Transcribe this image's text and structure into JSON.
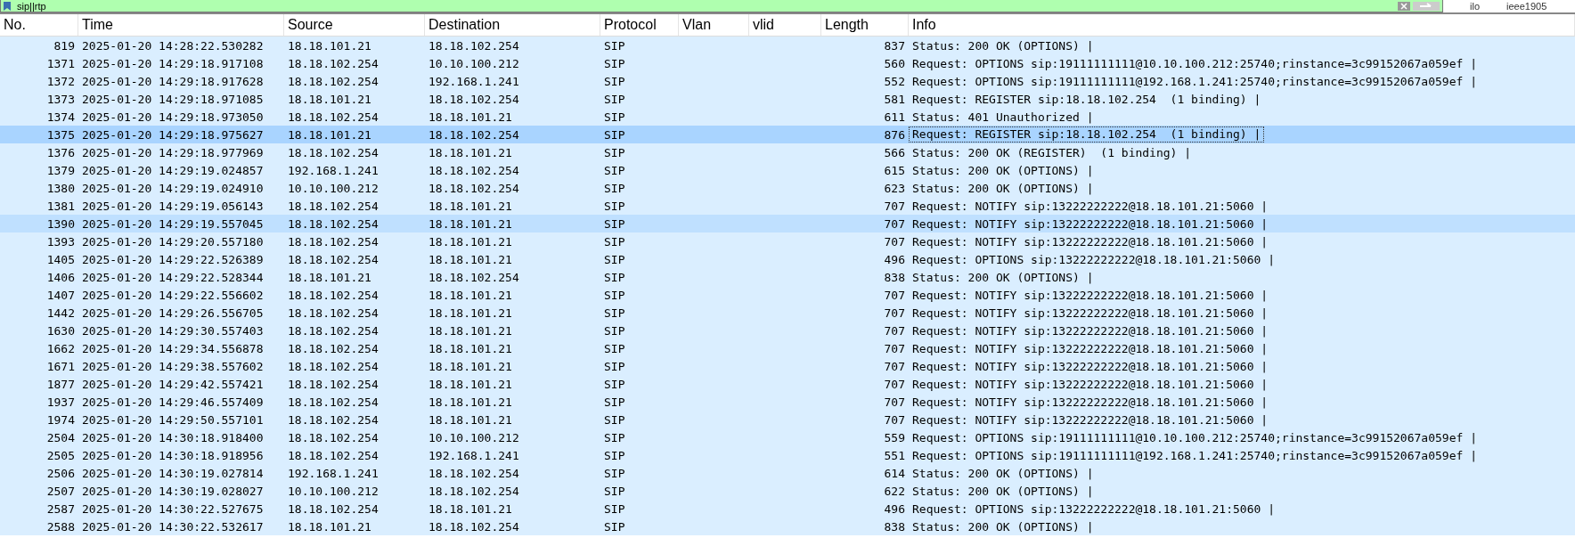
{
  "filter_bar": {
    "value": "sip||rtp",
    "buttons": [
      "ilo",
      "ieee1905"
    ]
  },
  "table": {
    "columns": [
      "No.",
      "Time",
      "Source",
      "Destination",
      "Protocol",
      "Vlan",
      "vlid",
      "Length",
      "Info"
    ],
    "rows": [
      {
        "no": "819",
        "time": "2025-01-20 14:28:22.530282",
        "source": "18.18.101.21",
        "destination": "18.18.102.254",
        "protocol": "SIP",
        "length": "837",
        "info": "Status: 200 OK (OPTIONS) |",
        "selected": false,
        "hover": false
      },
      {
        "no": "1371",
        "time": "2025-01-20 14:29:18.917108",
        "source": "18.18.102.254",
        "destination": "10.10.100.212",
        "protocol": "SIP",
        "length": "560",
        "info": "Request: OPTIONS sip:19111111111@10.10.100.212:25740;rinstance=3c99152067a059ef |",
        "selected": false,
        "hover": false
      },
      {
        "no": "1372",
        "time": "2025-01-20 14:29:18.917628",
        "source": "18.18.102.254",
        "destination": "192.168.1.241",
        "protocol": "SIP",
        "length": "552",
        "info": "Request: OPTIONS sip:19111111111@192.168.1.241:25740;rinstance=3c99152067a059ef |",
        "selected": false,
        "hover": false
      },
      {
        "no": "1373",
        "time": "2025-01-20 14:29:18.971085",
        "source": "18.18.101.21",
        "destination": "18.18.102.254",
        "protocol": "SIP",
        "length": "581",
        "info": "Request: REGISTER sip:18.18.102.254  (1 binding) |",
        "selected": false,
        "hover": false
      },
      {
        "no": "1374",
        "time": "2025-01-20 14:29:18.973050",
        "source": "18.18.102.254",
        "destination": "18.18.101.21",
        "protocol": "SIP",
        "length": "611",
        "info": "Status: 401 Unauthorized |",
        "selected": false,
        "hover": false
      },
      {
        "no": "1375",
        "time": "2025-01-20 14:29:18.975627",
        "source": "18.18.101.21",
        "destination": "18.18.102.254",
        "protocol": "SIP",
        "length": "876",
        "info": "Request: REGISTER sip:18.18.102.254  (1 binding) |",
        "selected": true,
        "hover": false
      },
      {
        "no": "1376",
        "time": "2025-01-20 14:29:18.977969",
        "source": "18.18.102.254",
        "destination": "18.18.101.21",
        "protocol": "SIP",
        "length": "566",
        "info": "Status: 200 OK (REGISTER)  (1 binding) |",
        "selected": false,
        "hover": false
      },
      {
        "no": "1379",
        "time": "2025-01-20 14:29:19.024857",
        "source": "192.168.1.241",
        "destination": "18.18.102.254",
        "protocol": "SIP",
        "length": "615",
        "info": "Status: 200 OK (OPTIONS) |",
        "selected": false,
        "hover": false
      },
      {
        "no": "1380",
        "time": "2025-01-20 14:29:19.024910",
        "source": "10.10.100.212",
        "destination": "18.18.102.254",
        "protocol": "SIP",
        "length": "623",
        "info": "Status: 200 OK (OPTIONS) |",
        "selected": false,
        "hover": false
      },
      {
        "no": "1381",
        "time": "2025-01-20 14:29:19.056143",
        "source": "18.18.102.254",
        "destination": "18.18.101.21",
        "protocol": "SIP",
        "length": "707",
        "info": "Request: NOTIFY sip:13222222222@18.18.101.21:5060 |",
        "selected": false,
        "hover": false
      },
      {
        "no": "1390",
        "time": "2025-01-20 14:29:19.557045",
        "source": "18.18.102.254",
        "destination": "18.18.101.21",
        "protocol": "SIP",
        "length": "707",
        "info": "Request: NOTIFY sip:13222222222@18.18.101.21:5060 |",
        "selected": false,
        "hover": true
      },
      {
        "no": "1393",
        "time": "2025-01-20 14:29:20.557180",
        "source": "18.18.102.254",
        "destination": "18.18.101.21",
        "protocol": "SIP",
        "length": "707",
        "info": "Request: NOTIFY sip:13222222222@18.18.101.21:5060 |",
        "selected": false,
        "hover": false
      },
      {
        "no": "1405",
        "time": "2025-01-20 14:29:22.526389",
        "source": "18.18.102.254",
        "destination": "18.18.101.21",
        "protocol": "SIP",
        "length": "496",
        "info": "Request: OPTIONS sip:13222222222@18.18.101.21:5060 |",
        "selected": false,
        "hover": false
      },
      {
        "no": "1406",
        "time": "2025-01-20 14:29:22.528344",
        "source": "18.18.101.21",
        "destination": "18.18.102.254",
        "protocol": "SIP",
        "length": "838",
        "info": "Status: 200 OK (OPTIONS) |",
        "selected": false,
        "hover": false
      },
      {
        "no": "1407",
        "time": "2025-01-20 14:29:22.556602",
        "source": "18.18.102.254",
        "destination": "18.18.101.21",
        "protocol": "SIP",
        "length": "707",
        "info": "Request: NOTIFY sip:13222222222@18.18.101.21:5060 |",
        "selected": false,
        "hover": false
      },
      {
        "no": "1442",
        "time": "2025-01-20 14:29:26.556705",
        "source": "18.18.102.254",
        "destination": "18.18.101.21",
        "protocol": "SIP",
        "length": "707",
        "info": "Request: NOTIFY sip:13222222222@18.18.101.21:5060 |",
        "selected": false,
        "hover": false
      },
      {
        "no": "1630",
        "time": "2025-01-20 14:29:30.557403",
        "source": "18.18.102.254",
        "destination": "18.18.101.21",
        "protocol": "SIP",
        "length": "707",
        "info": "Request: NOTIFY sip:13222222222@18.18.101.21:5060 |",
        "selected": false,
        "hover": false
      },
      {
        "no": "1662",
        "time": "2025-01-20 14:29:34.556878",
        "source": "18.18.102.254",
        "destination": "18.18.101.21",
        "protocol": "SIP",
        "length": "707",
        "info": "Request: NOTIFY sip:13222222222@18.18.101.21:5060 |",
        "selected": false,
        "hover": false
      },
      {
        "no": "1671",
        "time": "2025-01-20 14:29:38.557602",
        "source": "18.18.102.254",
        "destination": "18.18.101.21",
        "protocol": "SIP",
        "length": "707",
        "info": "Request: NOTIFY sip:13222222222@18.18.101.21:5060 |",
        "selected": false,
        "hover": false
      },
      {
        "no": "1877",
        "time": "2025-01-20 14:29:42.557421",
        "source": "18.18.102.254",
        "destination": "18.18.101.21",
        "protocol": "SIP",
        "length": "707",
        "info": "Request: NOTIFY sip:13222222222@18.18.101.21:5060 |",
        "selected": false,
        "hover": false
      },
      {
        "no": "1937",
        "time": "2025-01-20 14:29:46.557409",
        "source": "18.18.102.254",
        "destination": "18.18.101.21",
        "protocol": "SIP",
        "length": "707",
        "info": "Request: NOTIFY sip:13222222222@18.18.101.21:5060 |",
        "selected": false,
        "hover": false
      },
      {
        "no": "1974",
        "time": "2025-01-20 14:29:50.557101",
        "source": "18.18.102.254",
        "destination": "18.18.101.21",
        "protocol": "SIP",
        "length": "707",
        "info": "Request: NOTIFY sip:13222222222@18.18.101.21:5060 |",
        "selected": false,
        "hover": false
      },
      {
        "no": "2504",
        "time": "2025-01-20 14:30:18.918400",
        "source": "18.18.102.254",
        "destination": "10.10.100.212",
        "protocol": "SIP",
        "length": "559",
        "info": "Request: OPTIONS sip:19111111111@10.10.100.212:25740;rinstance=3c99152067a059ef |",
        "selected": false,
        "hover": false
      },
      {
        "no": "2505",
        "time": "2025-01-20 14:30:18.918956",
        "source": "18.18.102.254",
        "destination": "192.168.1.241",
        "protocol": "SIP",
        "length": "551",
        "info": "Request: OPTIONS sip:19111111111@192.168.1.241:25740;rinstance=3c99152067a059ef |",
        "selected": false,
        "hover": false
      },
      {
        "no": "2506",
        "time": "2025-01-20 14:30:19.027814",
        "source": "192.168.1.241",
        "destination": "18.18.102.254",
        "protocol": "SIP",
        "length": "614",
        "info": "Status: 200 OK (OPTIONS) |",
        "selected": false,
        "hover": false
      },
      {
        "no": "2507",
        "time": "2025-01-20 14:30:19.028027",
        "source": "10.10.100.212",
        "destination": "18.18.102.254",
        "protocol": "SIP",
        "length": "622",
        "info": "Status: 200 OK (OPTIONS) |",
        "selected": false,
        "hover": false
      },
      {
        "no": "2587",
        "time": "2025-01-20 14:30:22.527675",
        "source": "18.18.102.254",
        "destination": "18.18.101.21",
        "protocol": "SIP",
        "length": "496",
        "info": "Request: OPTIONS sip:13222222222@18.18.101.21:5060 |",
        "selected": false,
        "hover": false
      },
      {
        "no": "2588",
        "time": "2025-01-20 14:30:22.532617",
        "source": "18.18.101.21",
        "destination": "18.18.102.254",
        "protocol": "SIP",
        "length": "838",
        "info": "Status: 200 OK (OPTIONS) |",
        "selected": false,
        "hover": false
      }
    ]
  }
}
